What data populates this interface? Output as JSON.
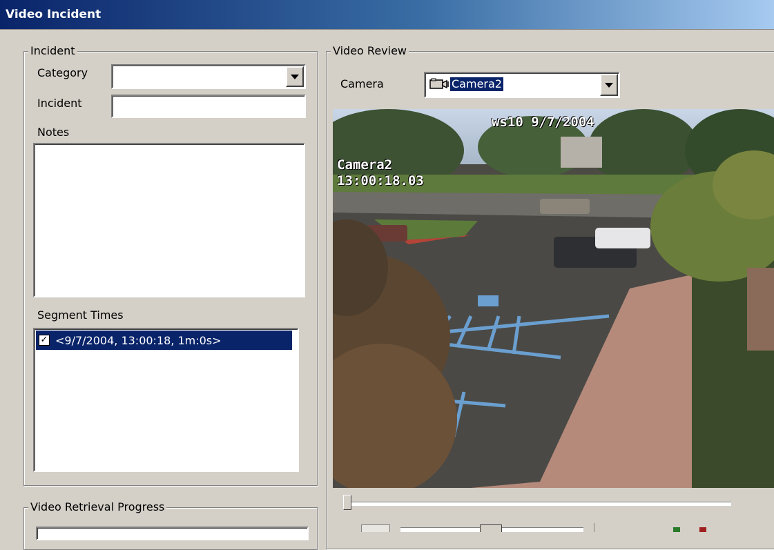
{
  "window": {
    "title": "Video Incident"
  },
  "incident": {
    "group_label": "Incident",
    "category_label": "Category",
    "category_value": "",
    "incident_label": "Incident",
    "incident_value": "",
    "notes_label": "Notes",
    "notes_value": "",
    "segment_times_label": "Segment Times",
    "segments": [
      {
        "label": "<9/7/2004, 13:00:18, 1m:0s>",
        "checked": true
      }
    ]
  },
  "progress": {
    "group_label": "Video Retrieval Progress"
  },
  "video_review": {
    "group_label": "Video Review",
    "camera_label": "Camera",
    "camera_selected": "Camera2",
    "camera_icon": "camera-icon",
    "overlay_header": "ws10 9/7/2004",
    "overlay_camera": "Camera2",
    "overlay_time": "13:00:18.03",
    "scrub_position": 0.0
  }
}
